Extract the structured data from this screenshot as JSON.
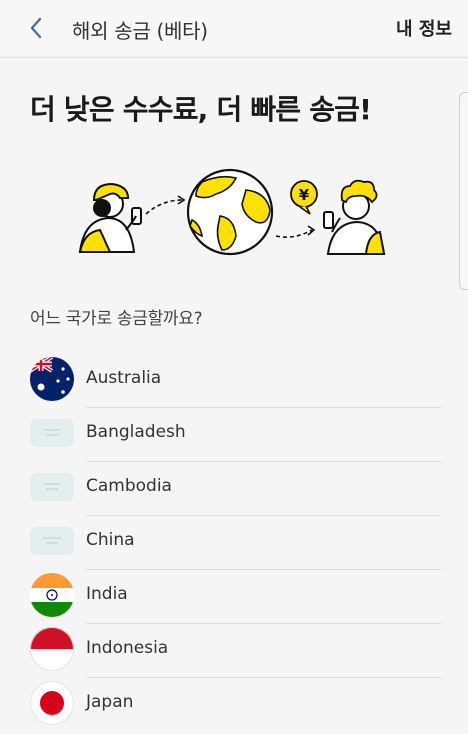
{
  "header": {
    "title": "해외 송금 (베타)",
    "info_label": "내 정보"
  },
  "headline": "더 낮은 수수료, 더 빠른 송금!",
  "illustration": {
    "currency_symbol": "¥"
  },
  "question": "어느 국가로 송금할까요?",
  "countries": [
    {
      "name": "Australia",
      "flag": "australia-flag-icon"
    },
    {
      "name": "Bangladesh",
      "flag": "placeholder-flag-icon"
    },
    {
      "name": "Cambodia",
      "flag": "placeholder-flag-icon"
    },
    {
      "name": "China",
      "flag": "placeholder-flag-icon"
    },
    {
      "name": "India",
      "flag": "india-flag-icon"
    },
    {
      "name": "Indonesia",
      "flag": "indonesia-flag-icon"
    },
    {
      "name": "Japan",
      "flag": "japan-flag-icon"
    }
  ],
  "colors": {
    "accent_yellow": "#ffe000",
    "back_arrow": "#4a6fa5"
  }
}
